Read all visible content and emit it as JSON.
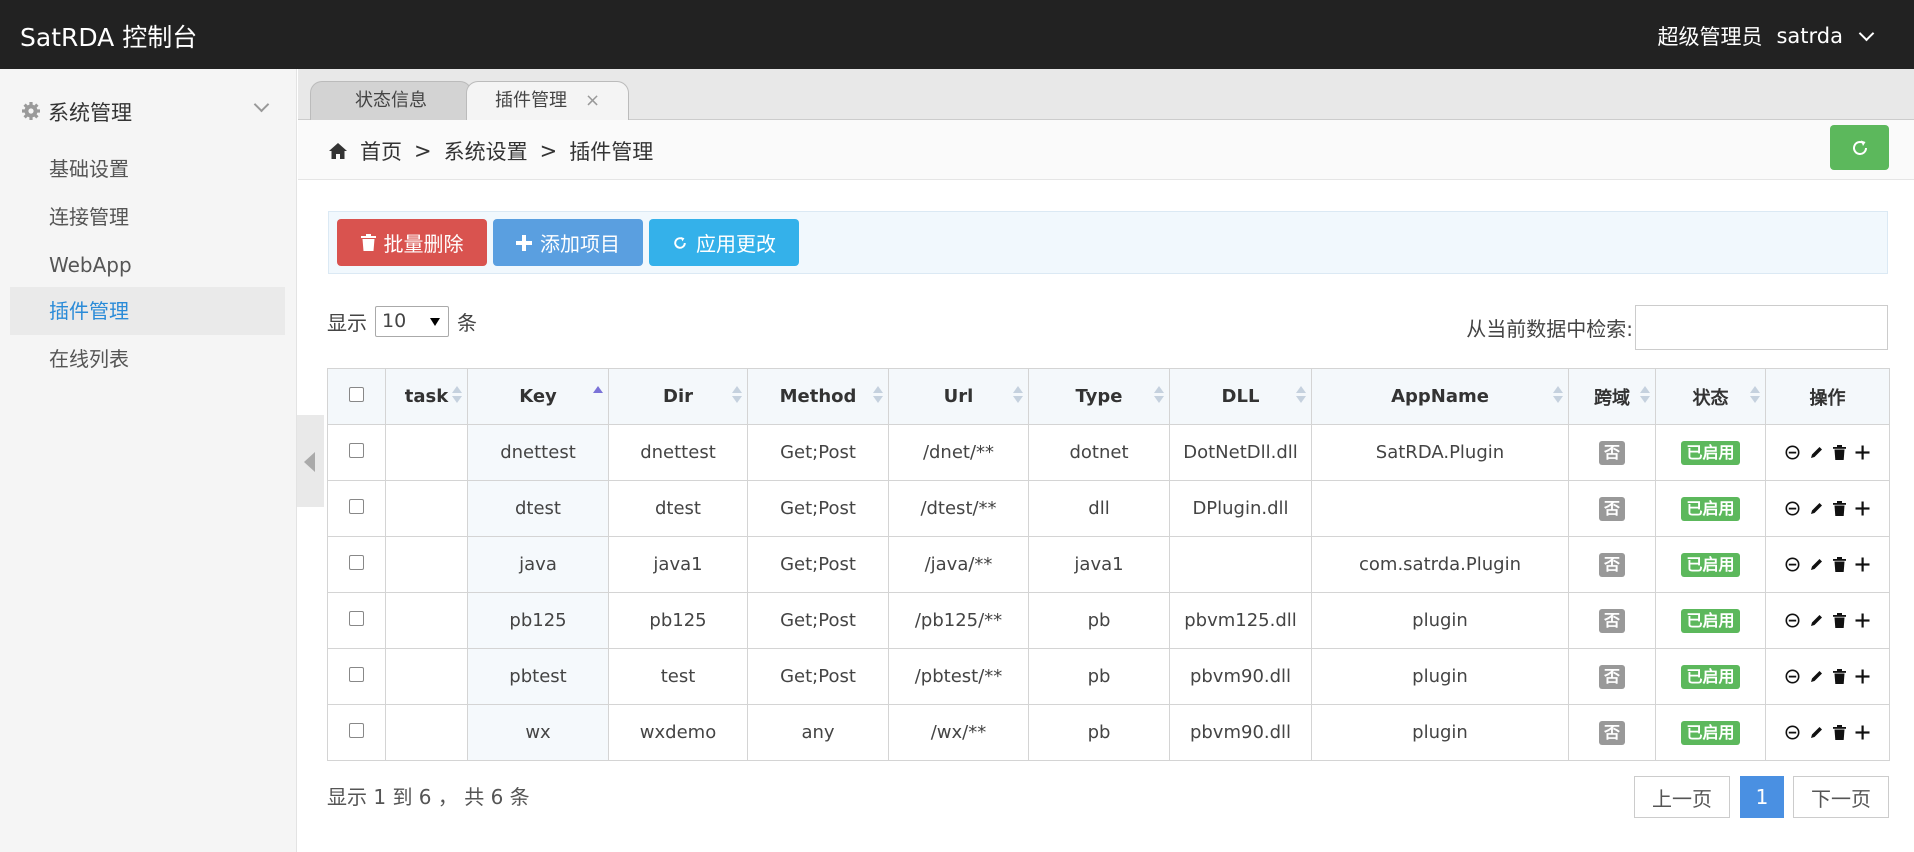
{
  "header": {
    "title": "SatRDA 控制台",
    "role": "超级管理员",
    "username": "satrda"
  },
  "sidebar": {
    "group_label": "系统管理",
    "items": [
      {
        "label": "基础设置"
      },
      {
        "label": "连接管理"
      },
      {
        "label": "WebApp"
      },
      {
        "label": "插件管理",
        "active": true
      },
      {
        "label": "在线列表"
      }
    ]
  },
  "tabs": [
    {
      "label": "状态信息"
    },
    {
      "label": "插件管理",
      "close": "×"
    }
  ],
  "breadcrumb": [
    "首页",
    ">",
    "系统设置",
    ">",
    "插件管理"
  ],
  "toolbar": {
    "batch_delete": "批量删除",
    "add_item": "添加项目",
    "apply_changes": "应用更改"
  },
  "length": {
    "prefix": "显示",
    "value": "10",
    "suffix": "条"
  },
  "search": {
    "label": "从当前数据中检索:"
  },
  "table": {
    "columns": [
      "task",
      "Key",
      "Dir",
      "Method",
      "Url",
      "Type",
      "DLL",
      "AppName",
      "跨域",
      "状态",
      "操作"
    ],
    "rows": [
      {
        "key": "dnettest",
        "dir": "dnettest",
        "method": "Get;Post",
        "url": "/dnet/**",
        "type": "dotnet",
        "dll": "DotNetDll.dll",
        "app": "SatRDA.Plugin",
        "cors": "否",
        "status": "已启用"
      },
      {
        "key": "dtest",
        "dir": "dtest",
        "method": "Get;Post",
        "url": "/dtest/**",
        "type": "dll",
        "dll": "DPlugin.dll",
        "app": "",
        "cors": "否",
        "status": "已启用"
      },
      {
        "key": "java",
        "dir": "java1",
        "method": "Get;Post",
        "url": "/java/**",
        "type": "java1",
        "dll": "",
        "app": "com.satrda.Plugin",
        "cors": "否",
        "status": "已启用"
      },
      {
        "key": "pb125",
        "dir": "pb125",
        "method": "Get;Post",
        "url": "/pb125/**",
        "type": "pb",
        "dll": "pbvm125.dll",
        "app": "plugin",
        "cors": "否",
        "status": "已启用"
      },
      {
        "key": "pbtest",
        "dir": "test",
        "method": "Get;Post",
        "url": "/pbtest/**",
        "type": "pb",
        "dll": "pbvm90.dll",
        "app": "plugin",
        "cors": "否",
        "status": "已启用"
      },
      {
        "key": "wx",
        "dir": "wxdemo",
        "method": "any",
        "url": "/wx/**",
        "type": "pb",
        "dll": "pbvm90.dll",
        "app": "plugin",
        "cors": "否",
        "status": "已启用"
      }
    ]
  },
  "footer": {
    "info": "显示 1 到 6 ， 共 6 条",
    "prev": "上一页",
    "page": "1",
    "next": "下一页"
  },
  "colors": {
    "topbar": "#222222",
    "danger": "#d9534f",
    "primary": "#5a9fe0",
    "info": "#34b1ea",
    "success": "#5cb85c",
    "active_link": "#2a8bd8"
  }
}
